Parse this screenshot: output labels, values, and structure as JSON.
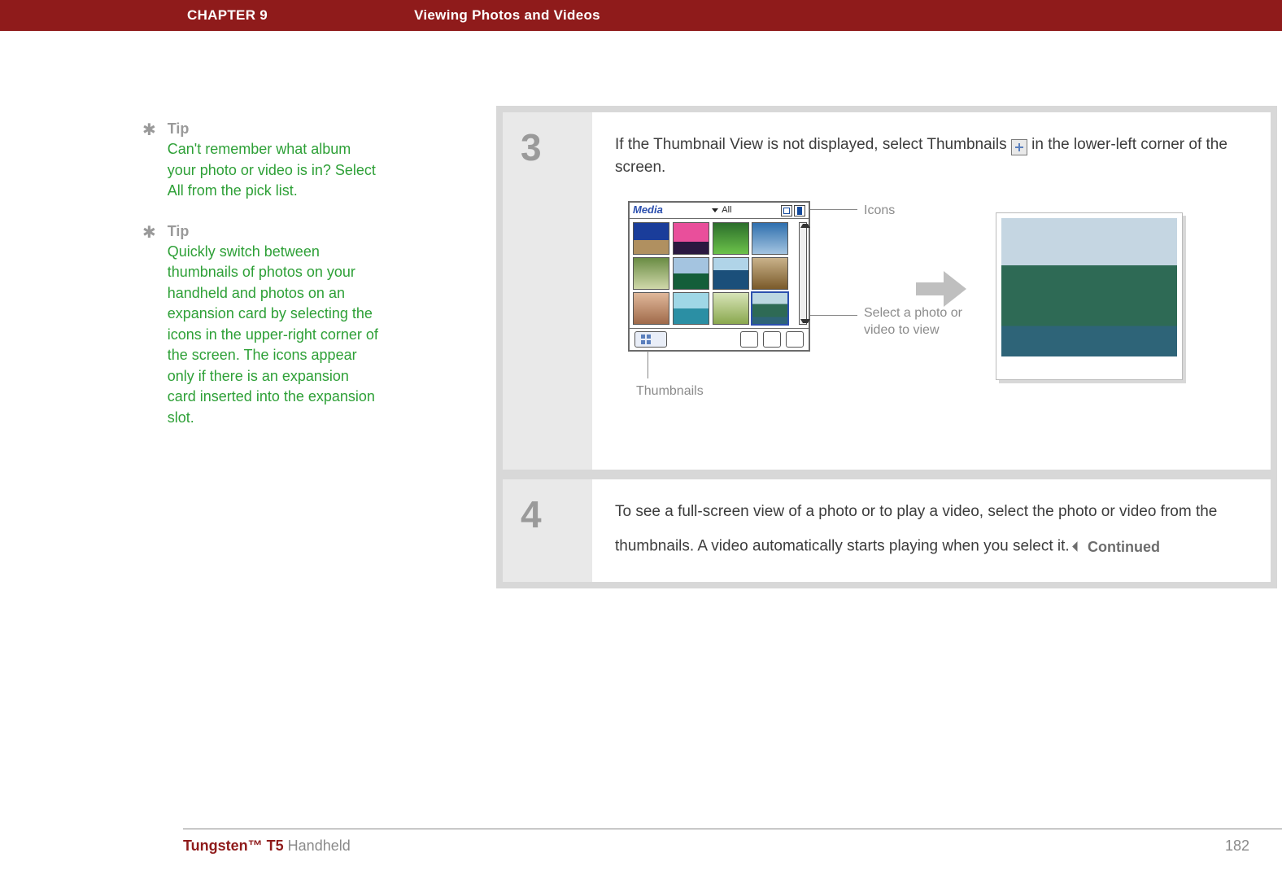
{
  "banner": {
    "chapter": "CHAPTER 9",
    "title": "Viewing Photos and Videos"
  },
  "tips": [
    {
      "label": "Tip",
      "text": "Can't remember what album your photo or video is in? Select All from the pick list."
    },
    {
      "label": "Tip",
      "text": "Quickly switch between thumbnails of photos on your handheld and photos on an expansion card by selecting the icons in the upper-right corner of the screen. The icons appear only if there is an expansion card inserted into the expansion slot."
    }
  ],
  "steps": {
    "s3": {
      "number": "3",
      "text_before": "If the Thumbnail View is not displayed, select Thumbnails ",
      "text_after": " in the lower-left corner of the screen.",
      "palm": {
        "app_name": "Media",
        "picklist": "All"
      },
      "ann": {
        "icons": "Icons",
        "select": "Select a photo or video to view",
        "thumbs": "Thumbnails"
      }
    },
    "s4": {
      "number": "4",
      "text": "To see a full-screen view of a photo or to play a video, select the photo or video from the thumbnails. A video automatically starts playing when you select it.",
      "continued": "Continued"
    }
  },
  "footer": {
    "product_strong": "Tungsten™ T5",
    "product_rest": " Handheld",
    "page": "182"
  },
  "thumb_styles": [
    "linear-gradient(#1a3d9a 0 55%, #b09060 55% 100%)",
    "linear-gradient(#e94f9b 0 60%, #2a1840 60% 100%)",
    "linear-gradient(#2b6e2b,#6cc24a)",
    "linear-gradient(#2e6fae,#a4c4e0)",
    "linear-gradient(#6a8c44,#d0d8aa)",
    "linear-gradient(#a4c4e0 0 50%, #145e3a 50% 100%)",
    "linear-gradient(#b0d4e8 0 40%, #1b4f7a 40% 100%)",
    "linear-gradient(#c9b28a,#7a5a2a)",
    "linear-gradient(#e0b89a,#a06a4a)",
    "linear-gradient(#9fd7e6 0 50%, #2b8fa4 50% 100%)",
    "linear-gradient(#d7e4b8,#8aa84e)",
    "linear-gradient(#bcd7e2 0 35%, #2e6a55 35% 78%, #2e6478 78% 100%)"
  ]
}
